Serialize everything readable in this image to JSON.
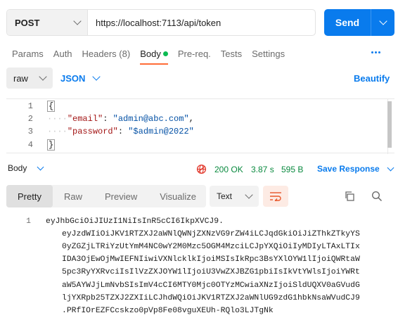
{
  "request": {
    "method": "POST",
    "url": "https://localhost:7113/api/token",
    "send_label": "Send"
  },
  "tabs": [
    {
      "label": "Params"
    },
    {
      "label": "Auth"
    },
    {
      "label": "Headers (8)"
    },
    {
      "label": "Body"
    },
    {
      "label": "Pre-req."
    },
    {
      "label": "Tests"
    },
    {
      "label": "Settings"
    }
  ],
  "body_options": {
    "mode": "raw",
    "format": "JSON",
    "beautify_label": "Beautify"
  },
  "editor": {
    "lines": [
      {
        "num": "1",
        "open": "{"
      },
      {
        "num": "2",
        "key": "\"email\"",
        "sep": ": ",
        "value": "\"admin@abc.com\"",
        "end": ","
      },
      {
        "num": "3",
        "key": "\"password\"",
        "sep": ": ",
        "value": "\"$admin@2022\"",
        "end": ""
      },
      {
        "num": "4",
        "close": "}"
      }
    ]
  },
  "response": {
    "label": "Body",
    "status": "200 OK",
    "time": "3.87 s",
    "size": "595 B",
    "save_label": "Save Response",
    "view_tabs": [
      "Pretty",
      "Raw",
      "Preview",
      "Visualize"
    ],
    "active_view": "Pretty",
    "text_format": "Text",
    "line_number": "1",
    "lines": [
      "eyJhbGciOiJIUzI1NiIsInR5cCI6IkpXVCJ9.",
      "eyJzdWIiOiJKV1RTZXJ2aWNlQWNjZXNzVG9rZW4iLCJqdGkiOiJiZThkZTkyYS",
      "0yZGZjLTRiYzUtYmM4NC0wY2M0Mzc5OGM4MzciLCJpYXQiOiIyMDIyLTAxLTIx",
      "IDA3OjEwOjMwIEFNIiwiVXNlcklkIjoiMSIsIkRpc3BsYXlOYW1lIjoiQWRtaW",
      "5pc3RyYXRvciIsIlVzZXJOYW1lIjoiU3VwZXJBZG1pbiIsIkVtYWlsIjoiYWRt",
      "aW5AYWJjLmNvbSIsImV4cCI6MTY0Mjc0OTYzMCwiaXNzIjoiSldUQXV0aGVudG",
      "ljYXRpb25TZXJ2ZXIiLCJhdWQiOiJKV1RTZXJ2aWNlUG9zdG1hbkNsaWVudCJ9",
      ".PRfIOrEZFCcskzo0pVp8Fe08vguXEUh-RQlo3LJTgNk"
    ]
  },
  "colors": {
    "accent": "#097bed",
    "active_tab_underline": "#ff6c37",
    "status_ok": "#0a8a3f",
    "body_dot": "#0cbb52"
  }
}
